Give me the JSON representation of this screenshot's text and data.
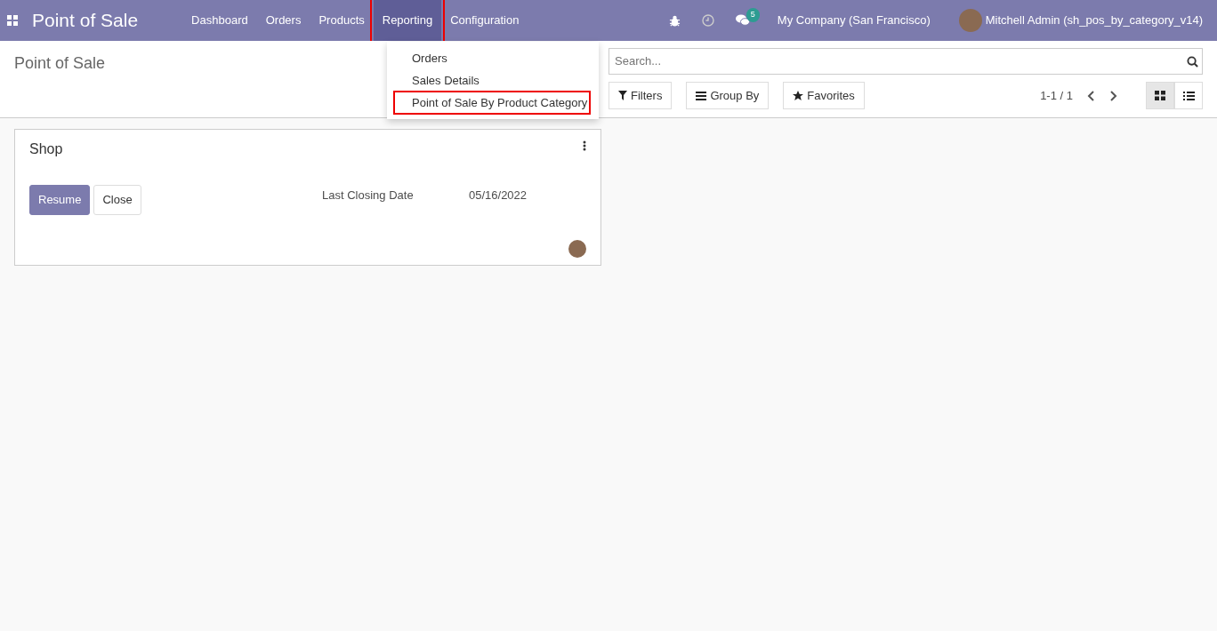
{
  "app_title": "Point of Sale",
  "menu": [
    {
      "label": "Dashboard",
      "selected": false,
      "highlighted": false
    },
    {
      "label": "Orders",
      "selected": false,
      "highlighted": false
    },
    {
      "label": "Products",
      "selected": false,
      "highlighted": false
    },
    {
      "label": "Reporting",
      "selected": true,
      "highlighted": true
    },
    {
      "label": "Configuration",
      "selected": false,
      "highlighted": false
    }
  ],
  "systray": {
    "messages_count": "5",
    "company": "My Company (San Francisco)",
    "user": "Mitchell Admin (sh_pos_by_category_v14)"
  },
  "dropdown": {
    "items": [
      {
        "label": "Orders",
        "highlighted": false
      },
      {
        "label": "Sales Details",
        "highlighted": false
      },
      {
        "label": "Point of Sale By Product Category",
        "highlighted": true
      }
    ]
  },
  "breadcrumb": "Point of Sale",
  "search": {
    "placeholder": "Search..."
  },
  "filter_buttons": [
    {
      "label": "Filters",
      "kind": "filter"
    },
    {
      "label": "Group By",
      "kind": "group"
    },
    {
      "label": "Favorites",
      "kind": "star"
    }
  ],
  "pager": "1-1 / 1",
  "views": [
    {
      "kind": "kanban",
      "selected": true
    },
    {
      "kind": "list",
      "selected": false
    }
  ],
  "card": {
    "title": "Shop",
    "buttons": [
      {
        "label": "Resume",
        "kind": "primary"
      },
      {
        "label": "Close",
        "kind": "secondary"
      }
    ],
    "field_label": "Last Closing Date",
    "field_value": "05/16/2022"
  }
}
